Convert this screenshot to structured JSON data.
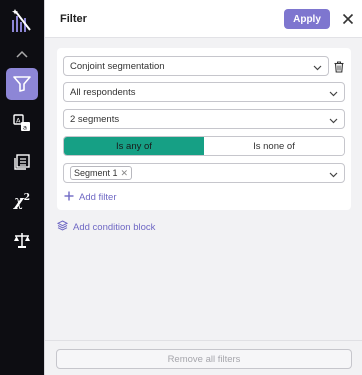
{
  "rail": {
    "items": [
      {
        "name": "logo-icon"
      },
      {
        "name": "collapse-chevron-icon"
      },
      {
        "name": "filter-icon",
        "active": true
      },
      {
        "name": "translate-icon"
      },
      {
        "name": "cards-icon"
      },
      {
        "name": "chi-square-icon",
        "label": "χ",
        "sup": "2"
      },
      {
        "name": "balance-scale-icon"
      }
    ],
    "accent": "#8d86d6"
  },
  "header": {
    "title": "Filter",
    "apply_label": "Apply",
    "close_icon": "close-icon"
  },
  "filter_card": {
    "question_select": "Conjoint segmentation",
    "respondents_select": "All respondents",
    "segments_select": "2 segments",
    "toggle": {
      "options": [
        "Is any of",
        "Is none of"
      ],
      "selected": "Is any of"
    },
    "values": {
      "chips": [
        {
          "label": "Segment 1"
        }
      ]
    },
    "add_filter_label": "Add filter"
  },
  "add_condition_block_label": "Add condition block",
  "footer": {
    "remove_all_label": "Remove all filters"
  },
  "colors": {
    "apply": "#7e76cf",
    "toggle_active": "#16a085",
    "link": "#6f68c4"
  }
}
